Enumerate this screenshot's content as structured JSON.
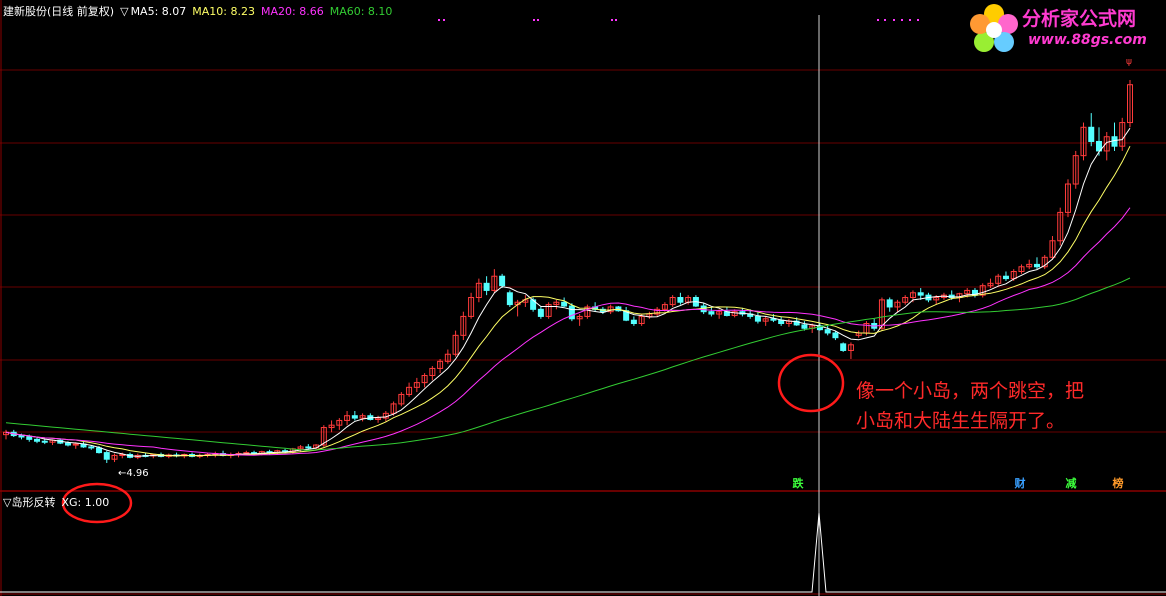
{
  "header": {
    "stock": "建新股份(日线 前复权)",
    "ma5": "MA5: 8.07",
    "ma10": "MA10: 8.23",
    "ma20": "MA20: 8.66",
    "ma60": "MA60: 8.10",
    "arrow_icon": "triangle-down-icon"
  },
  "indicator": {
    "name": "岛形反转",
    "value": "XG: 1.00"
  },
  "logo": {
    "title": "分析家公式网",
    "url": "www.88gs.com"
  },
  "annotation": {
    "line1": "像一个小岛，两个跳空，把",
    "line2": "小岛和大陆生生隔开了。"
  },
  "markers": [
    {
      "label": "跌",
      "color": "#3cff3c"
    },
    {
      "label": "财",
      "color": "#39a0ff"
    },
    {
      "label": "减",
      "color": "#3cff3c"
    },
    {
      "label": "榜",
      "color": "#ff9a2a"
    }
  ],
  "colors": {
    "up": "#ff3b3b",
    "down": "#54ffff",
    "ma5": "#ffffff",
    "ma10": "#ffff66",
    "ma20": "#ff33ff",
    "ma60": "#33cc33",
    "grid": "#8a0000",
    "circle": "#ff1a1a"
  },
  "chart_data": {
    "type": "candlestick",
    "low_label": "4.96",
    "last_value": "8.07",
    "series": [
      {
        "name": "MA5",
        "value": 8.07
      },
      {
        "name": "MA10",
        "value": 8.23
      },
      {
        "name": "MA20",
        "value": 8.66
      },
      {
        "name": "MA60",
        "value": 8.1
      }
    ],
    "indicator_series": {
      "name": "XG",
      "value": 1.0
    }
  }
}
